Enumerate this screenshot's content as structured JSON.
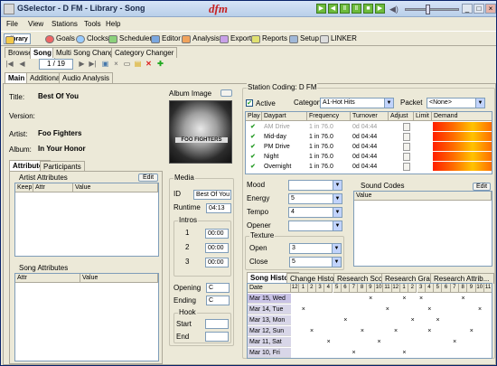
{
  "window": {
    "title": "GSelector - D FM - Library - Song",
    "brand": "dfm"
  },
  "menu": [
    "File",
    "View",
    "Stations",
    "Tools",
    "Help"
  ],
  "toolbar": [
    {
      "label": "Library",
      "icon": "library-icon",
      "selected": true
    },
    {
      "label": "Goals",
      "icon": "goals-icon"
    },
    {
      "label": "Clocks",
      "icon": "clock-icon"
    },
    {
      "label": "Scheduler",
      "icon": "scheduler-icon"
    },
    {
      "label": "Editor",
      "icon": "editor-icon"
    },
    {
      "label": "Analysis",
      "icon": "analysis-icon"
    },
    {
      "label": "Export",
      "icon": "export-icon"
    },
    {
      "label": "Reports",
      "icon": "reports-icon"
    },
    {
      "label": "Setup",
      "icon": "setup-icon"
    },
    {
      "label": "LINKER",
      "icon": "linker-icon"
    }
  ],
  "library_tabs": [
    "Browse",
    "Song",
    "Multi Song Changer",
    "Category Changer"
  ],
  "navigation": {
    "page": "1 / 19"
  },
  "song_tabs": [
    "Main",
    "Additional",
    "Audio Analysis"
  ],
  "song": {
    "title_label": "Title:",
    "title": "Best Of You",
    "version_label": "Version:",
    "version": "",
    "artist_label": "Artist:",
    "artist": "Foo Fighters",
    "album_label": "Album:",
    "album": "In Your Honor",
    "album_image_label": "Album Image",
    "album_art_text": "FOO FIGHTERS"
  },
  "attr_tabs": [
    "Attributes",
    "Participants"
  ],
  "artist_attributes": {
    "label": "Artist Attributes",
    "edit": "Edit",
    "columns": [
      "Keep",
      "Attr",
      "Value"
    ]
  },
  "song_attributes": {
    "label": "Song Attributes",
    "columns": [
      "Attr",
      "Value"
    ]
  },
  "media": {
    "label": "Media",
    "id_label": "ID",
    "id": "Best Of You",
    "runtime_label": "Runtime",
    "runtime": "04:13",
    "intros_label": "Intros",
    "intros": [
      {
        "n": "1",
        "v": "00:00"
      },
      {
        "n": "2",
        "v": "00:00"
      },
      {
        "n": "3",
        "v": "00:00"
      }
    ],
    "opening_label": "Opening",
    "opening": "C",
    "ending_label": "Ending",
    "ending": "C",
    "hook_label": "Hook",
    "start_label": "Start",
    "end_label": "End"
  },
  "station": {
    "label": "Station Coding: D FM",
    "active_label": "Active",
    "category_label": "Category",
    "category": "A1-Hot Hits",
    "packet_label": "Packet",
    "packet": "<None>"
  },
  "dayparts": {
    "columns": [
      "Play",
      "Daypart",
      "Frequency",
      "Turnover",
      "Adjust",
      "Limit",
      "Demand"
    ],
    "rows": [
      {
        "daypart": "AM Drive",
        "freq": "1 in  76.0",
        "turn": "0d 04:44",
        "dim": true
      },
      {
        "daypart": "Mid-day",
        "freq": "1 in  76.0",
        "turn": "0d 04:44"
      },
      {
        "daypart": "PM Drive",
        "freq": "1 in  76.0",
        "turn": "0d 04:44"
      },
      {
        "daypart": "Night",
        "freq": "1 in  76.0",
        "turn": "0d 04:44"
      },
      {
        "daypart": "Overnight",
        "freq": "1 in  76.0",
        "turn": "0d 04:44"
      }
    ]
  },
  "codes": {
    "mood_label": "Mood",
    "energy_label": "Energy",
    "energy": "5",
    "tempo_label": "Tempo",
    "tempo": "4",
    "opener_label": "Opener",
    "texture_label": "Texture",
    "open_label": "Open",
    "open": "3",
    "close_label": "Close",
    "close": "5"
  },
  "sound_codes": {
    "label": "Sound Codes",
    "edit": "Edit",
    "column": "Value"
  },
  "history_tabs": [
    "Song History",
    "Change History",
    "Research Scores",
    "Research Graph",
    "Research Attrib..."
  ],
  "history": {
    "date_label": "Date",
    "hours": [
      "12",
      "1",
      "2",
      "3",
      "4",
      "5",
      "6",
      "7",
      "8",
      "9",
      "10",
      "11",
      "12",
      "1",
      "2",
      "3",
      "4",
      "5",
      "6",
      "7",
      "8",
      "9",
      "10",
      "11"
    ],
    "rows": [
      {
        "date": "Mar 15, Wed",
        "marks": [
          9,
          13,
          15,
          20
        ]
      },
      {
        "date": "Mar 14, Tue",
        "marks": [
          1,
          11,
          16,
          22
        ]
      },
      {
        "date": "Mar 13, Mon",
        "marks": [
          6,
          14,
          17
        ]
      },
      {
        "date": "Mar 12, Sun",
        "marks": [
          2,
          8,
          12,
          16,
          21
        ]
      },
      {
        "date": "Mar 11, Sat",
        "marks": [
          4,
          10,
          19
        ]
      },
      {
        "date": "Mar 10, Fri",
        "marks": [
          7,
          13
        ]
      }
    ]
  }
}
